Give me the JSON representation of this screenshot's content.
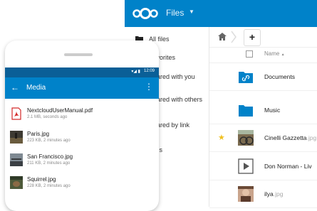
{
  "app": {
    "title": "Files"
  },
  "sidebar": {
    "items": [
      {
        "label": "All files",
        "icon": "folder-icon"
      },
      {
        "label": "Favorites",
        "icon": "star-icon"
      },
      {
        "label": "Shared with you",
        "icon": "share-icon"
      },
      {
        "label": "Shared with others",
        "icon": "share-icon"
      },
      {
        "label": "Shared by link",
        "icon": "link-icon"
      },
      {
        "label": "Tags",
        "icon": "tag-icon"
      }
    ]
  },
  "files": {
    "add_button": "+",
    "column_name": "Name",
    "sort_indicator": "▲",
    "rows": [
      {
        "name": "Documents",
        "ext": "",
        "type": "shared-folder",
        "favorite": false
      },
      {
        "name": "Music",
        "ext": "",
        "type": "folder",
        "favorite": false
      },
      {
        "name": "Cinelli Gazzetta",
        "ext": ".jpg",
        "type": "image",
        "favorite": true
      },
      {
        "name": "Don Norman - Liv",
        "ext": "",
        "type": "video",
        "favorite": false
      },
      {
        "name": "ilya",
        "ext": ".jpg",
        "type": "image",
        "favorite": false
      }
    ]
  },
  "phone": {
    "status_time": "12:09",
    "status_icons": "▾◢ ▮",
    "title": "Media",
    "items": [
      {
        "name": "NextcloudUserManual.pdf",
        "meta": "2.1 MB, seconds ago",
        "icon": "pdf-icon"
      },
      {
        "name": "Paris.jpg",
        "meta": "223 KB, 2 minutes ago",
        "icon": "image-thumb"
      },
      {
        "name": "San Francisco.jpg",
        "meta": "211 KB, 2 minutes ago",
        "icon": "image-thumb"
      },
      {
        "name": "Squirrel.jpg",
        "meta": "228 KB, 2 minutes ago",
        "icon": "image-thumb"
      }
    ]
  },
  "colors": {
    "brand": "#0082c9",
    "statusbar": "#0a5f97",
    "star": "#f0c020"
  }
}
